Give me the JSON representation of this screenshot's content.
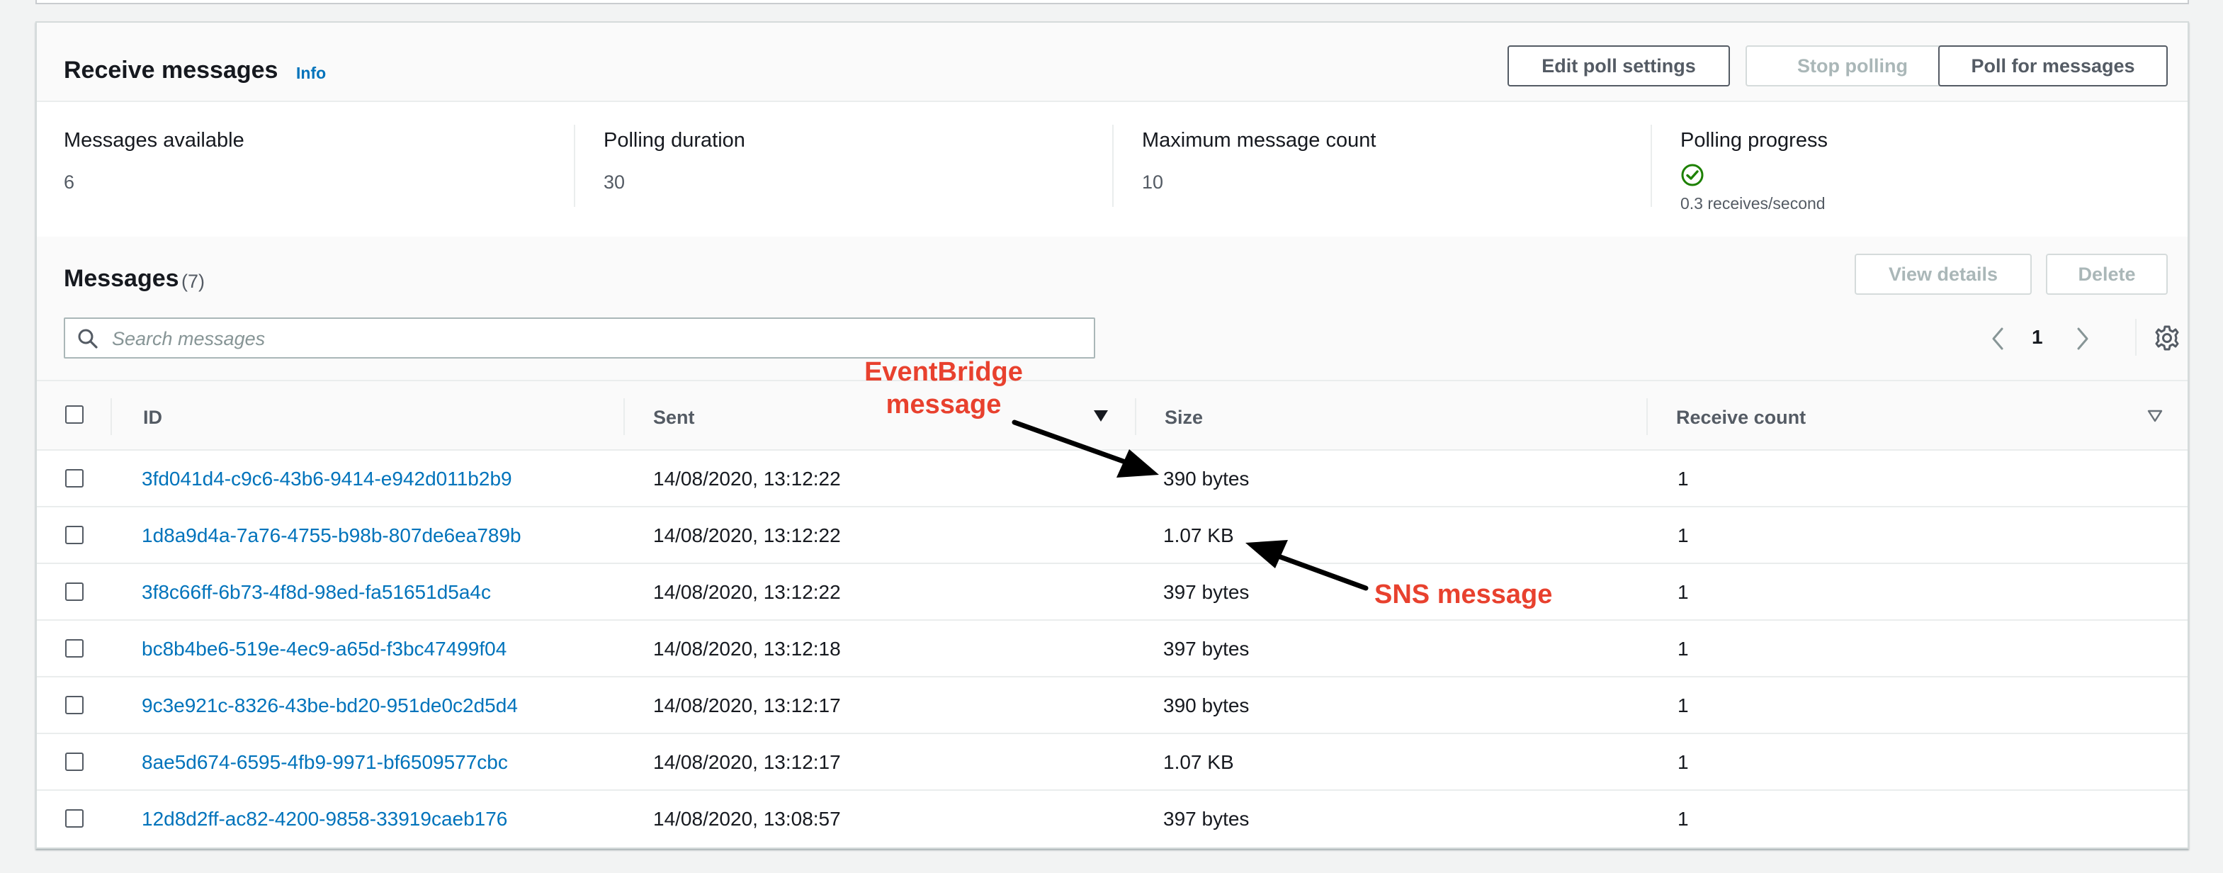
{
  "receive": {
    "title": "Receive messages",
    "info": "Info",
    "buttons": {
      "edit_poll": "Edit poll settings",
      "stop_polling": "Stop polling",
      "poll_messages": "Poll for messages"
    }
  },
  "stats": {
    "messages_available": {
      "label": "Messages available",
      "value": "6"
    },
    "polling_duration": {
      "label": "Polling duration",
      "value": "30"
    },
    "max_count": {
      "label": "Maximum message count",
      "value": "10"
    },
    "polling_progress": {
      "label": "Polling progress",
      "value": "0.3 receives/second"
    }
  },
  "messages": {
    "title": "Messages",
    "count": "(7)",
    "view_details": "View details",
    "delete": "Delete",
    "search_placeholder": "Search messages",
    "page": "1"
  },
  "table": {
    "headers": {
      "id": "ID",
      "sent": "Sent",
      "size": "Size",
      "receive_count": "Receive count"
    },
    "rows": [
      {
        "id": "3fd041d4-c9c6-43b6-9414-e942d011b2b9",
        "sent": "14/08/2020, 13:12:22",
        "size": "390 bytes",
        "receive_count": "1"
      },
      {
        "id": "1d8a9d4a-7a76-4755-b98b-807de6ea789b",
        "sent": "14/08/2020, 13:12:22",
        "size": "1.07 KB",
        "receive_count": "1"
      },
      {
        "id": "3f8c66ff-6b73-4f8d-98ed-fa51651d5a4c",
        "sent": "14/08/2020, 13:12:22",
        "size": "397 bytes",
        "receive_count": "1"
      },
      {
        "id": "bc8b4be6-519e-4ec9-a65d-f3bc47499f04",
        "sent": "14/08/2020, 13:12:18",
        "size": "397 bytes",
        "receive_count": "1"
      },
      {
        "id": "9c3e921c-8326-43be-bd20-951de0c2d5d4",
        "sent": "14/08/2020, 13:12:17",
        "size": "390 bytes",
        "receive_count": "1"
      },
      {
        "id": "8ae5d674-6595-4fb9-9971-bf6509577cbc",
        "sent": "14/08/2020, 13:12:17",
        "size": "1.07 KB",
        "receive_count": "1"
      },
      {
        "id": "12d8d2ff-ac82-4200-9858-33919caeb176",
        "sent": "14/08/2020, 13:08:57",
        "size": "397 bytes",
        "receive_count": "1"
      }
    ]
  },
  "annotations": {
    "eventbridge": "EventBridge message",
    "sns": "SNS message"
  },
  "icons": {
    "search": "search-icon",
    "settings": "gear-icon",
    "prev": "chevron-left-icon",
    "next": "chevron-right-icon",
    "success": "check-circle-icon",
    "sort_desc": "caret-down-icon",
    "sort_none": "caret-down-outline-icon"
  },
  "colors": {
    "link": "#0073bb",
    "annotation": "#e8412e",
    "success": "#1d8102"
  }
}
